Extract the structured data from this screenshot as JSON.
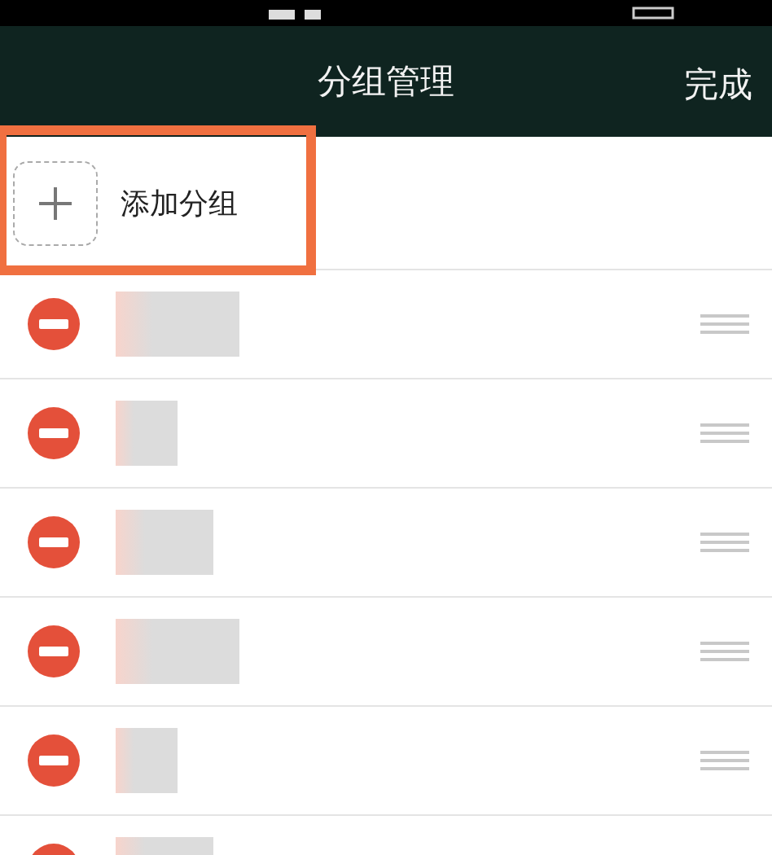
{
  "header": {
    "title": "分组管理",
    "done": "完成"
  },
  "add_group": {
    "label": "添加分组",
    "highlighted": true
  },
  "groups": [
    {
      "kind": "redacted"
    },
    {
      "kind": "redacted"
    },
    {
      "kind": "redacted"
    },
    {
      "kind": "redacted"
    },
    {
      "kind": "redacted"
    },
    {
      "kind": "redacted"
    }
  ]
}
